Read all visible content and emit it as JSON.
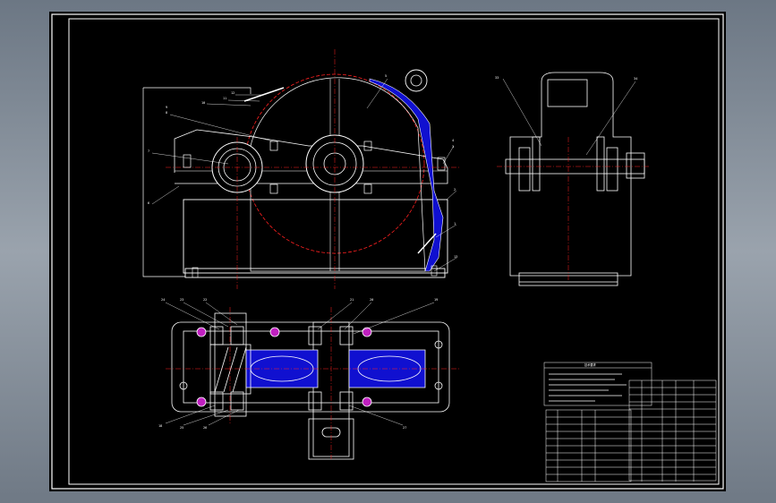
{
  "viewport": {
    "background": "#000000"
  },
  "colors": {
    "line": "#ffffff",
    "center_line": "#ff2020",
    "section_fill": "#1010d0",
    "frame": "#ffffff"
  },
  "top_view": {
    "part_labels": [
      "12",
      "11",
      "10",
      "9",
      "8",
      "7",
      "6",
      "5",
      "4",
      "3",
      "2",
      "1",
      "13",
      "14",
      "15",
      "16",
      "17"
    ]
  },
  "plan_view": {
    "part_labels": [
      "24",
      "23",
      "22",
      "21",
      "20",
      "19",
      "18",
      "25",
      "26",
      "27",
      "28",
      "29",
      "30",
      "31",
      "32"
    ]
  },
  "side_view": {
    "part_labels": [
      "33",
      "34"
    ]
  },
  "title_block": {
    "notes_title": "技术要求"
  }
}
